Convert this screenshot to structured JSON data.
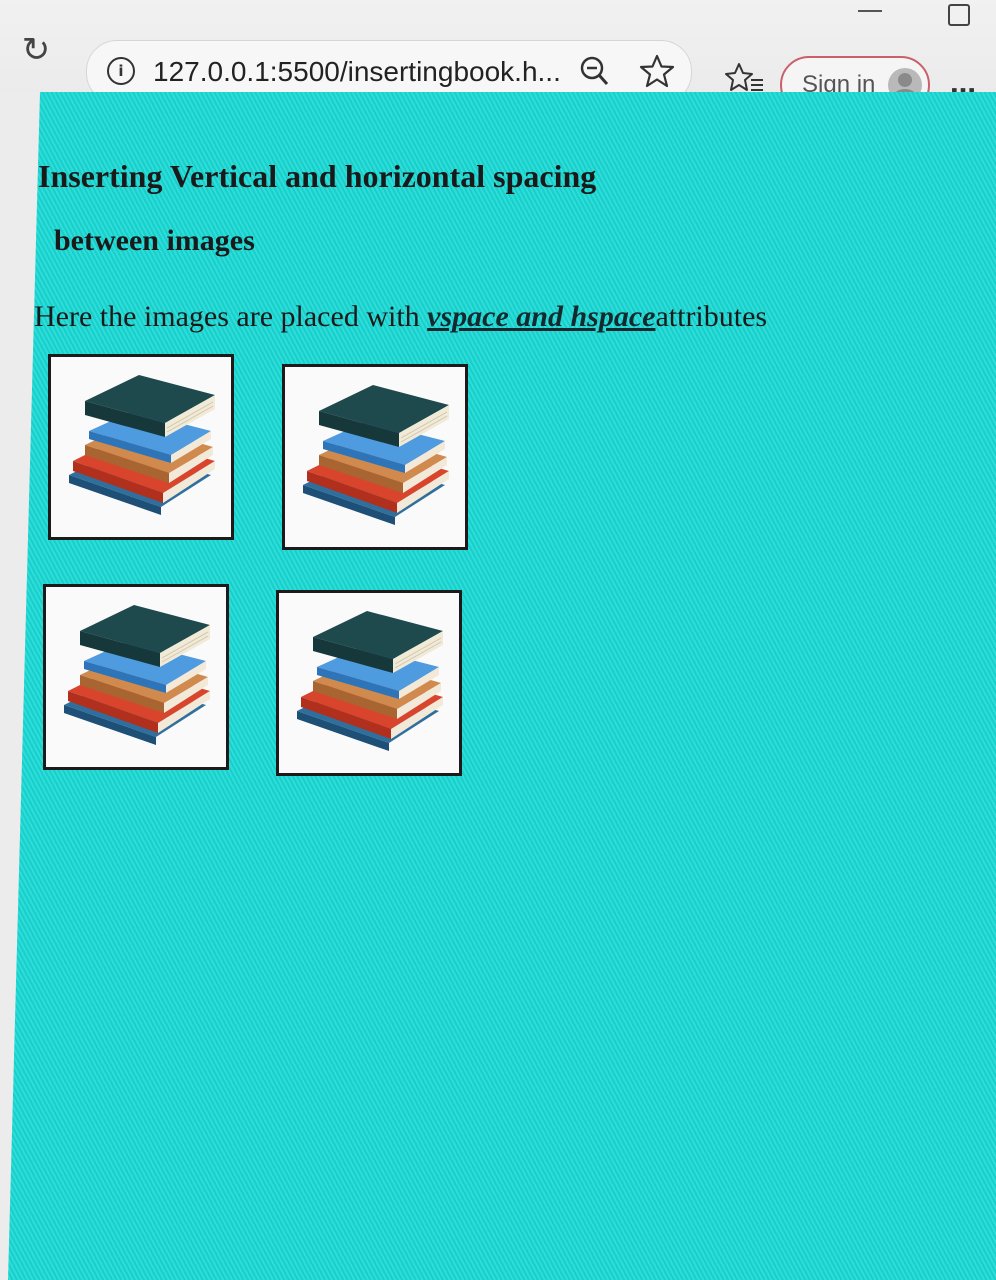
{
  "browser": {
    "url": "127.0.0.1:5500/insertingbook.h...",
    "sign_in_label": "Sign in",
    "icons": [
      "reload-icon",
      "info-icon",
      "zoom-out-icon",
      "star-icon",
      "favorites-icon",
      "avatar-icon",
      "more-icon"
    ]
  },
  "page": {
    "heading_line1": "Inserting Vertical and horizontal spacing",
    "heading_line2": "between images",
    "para_prefix": "Here the images are placed with ",
    "para_emphasis": "vspace and hspace",
    "para_suffix": "attributes",
    "background_color": "#18d8d4",
    "images": [
      {
        "subject": "stack-of-books"
      },
      {
        "subject": "stack-of-books"
      },
      {
        "subject": "stack-of-books"
      },
      {
        "subject": "stack-of-books"
      }
    ]
  }
}
